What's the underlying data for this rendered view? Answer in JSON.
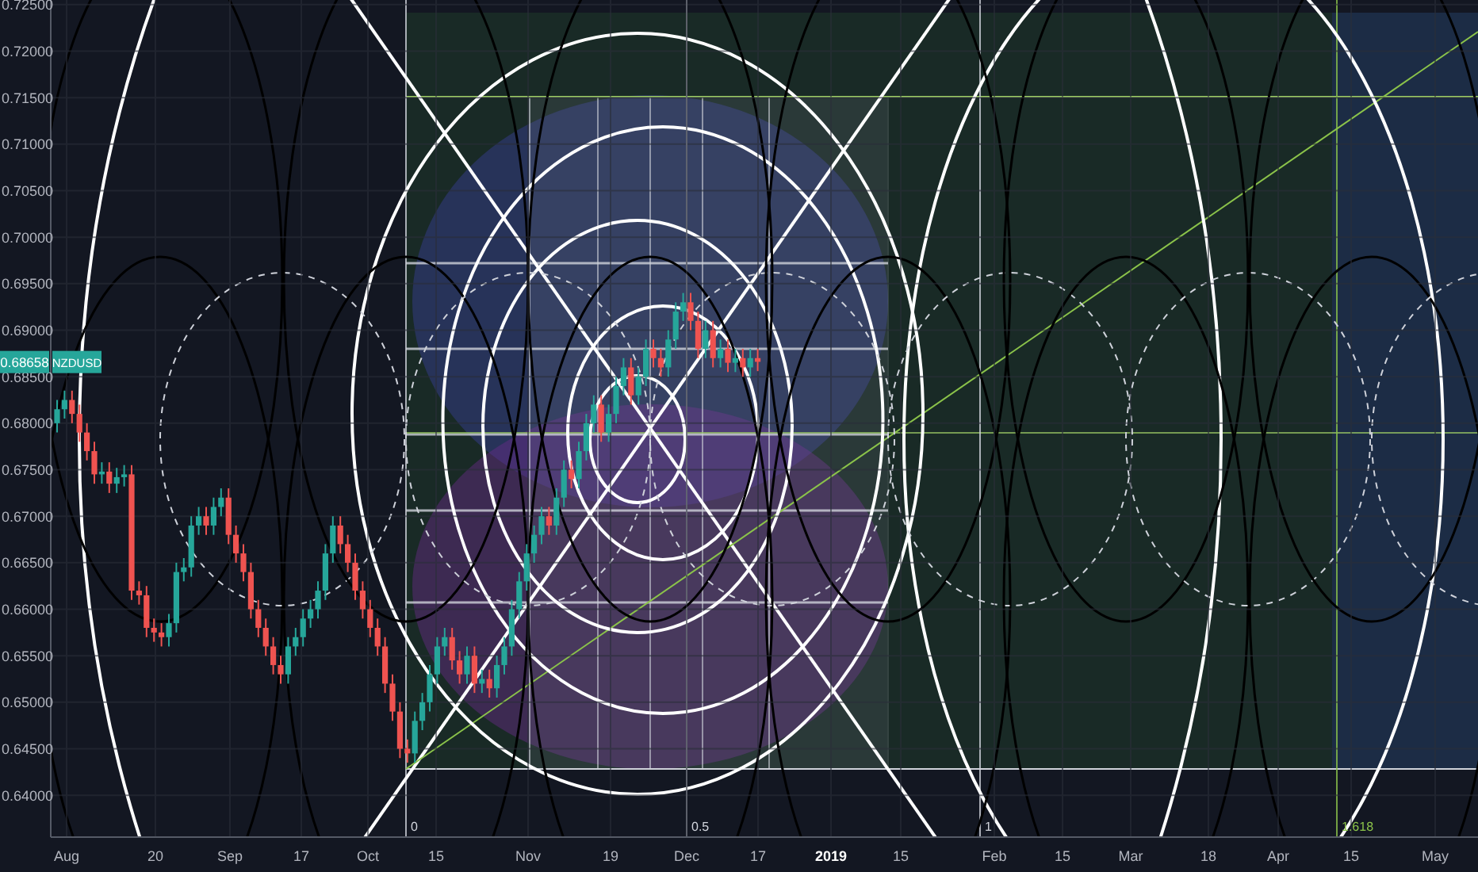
{
  "symbol": {
    "ticker": "NZDUSD",
    "last_price": "0.68658"
  },
  "chart_data": {
    "type": "candlestick",
    "grid": true,
    "ylim": [
      0.6355,
      0.7255
    ],
    "yticks": [
      {
        "value": 0.725,
        "label": "0.72500"
      },
      {
        "value": 0.72,
        "label": "0.72000"
      },
      {
        "value": 0.715,
        "label": "0.71500"
      },
      {
        "value": 0.71,
        "label": "0.71000"
      },
      {
        "value": 0.705,
        "label": "0.70500"
      },
      {
        "value": 0.7,
        "label": "0.70000"
      },
      {
        "value": 0.695,
        "label": "0.69500"
      },
      {
        "value": 0.69,
        "label": "0.69000"
      },
      {
        "value": 0.685,
        "label": "0.68500"
      },
      {
        "value": 0.68,
        "label": "0.68000"
      },
      {
        "value": 0.675,
        "label": "0.67500"
      },
      {
        "value": 0.67,
        "label": "0.67000"
      },
      {
        "value": 0.665,
        "label": "0.66500"
      },
      {
        "value": 0.66,
        "label": "0.66000"
      },
      {
        "value": 0.655,
        "label": "0.65500"
      },
      {
        "value": 0.65,
        "label": "0.65000"
      },
      {
        "value": 0.645,
        "label": "0.64500"
      },
      {
        "value": 0.64,
        "label": "0.64000"
      }
    ],
    "categories": [
      null,
      null,
      null,
      null,
      null,
      null,
      null,
      null,
      null,
      null,
      null,
      null,
      null,
      null,
      null,
      null,
      null,
      null,
      null,
      null,
      null,
      null,
      null,
      null,
      null,
      null,
      null,
      null,
      null,
      null,
      null,
      null,
      null,
      null,
      null,
      null,
      null,
      null,
      null,
      null,
      null,
      null,
      null,
      null,
      null,
      null,
      null,
      null,
      null,
      null,
      null,
      null,
      null,
      null,
      null,
      null,
      null,
      null,
      null,
      null,
      null,
      null,
      null,
      null,
      null,
      null,
      null,
      null,
      null,
      null,
      null,
      null,
      null,
      null,
      null,
      null,
      null,
      null,
      null,
      null,
      null,
      null,
      null,
      null,
      null,
      null,
      null,
      null,
      null,
      null,
      null,
      null,
      null,
      null,
      null
    ],
    "ohlc": [
      [
        0.68,
        0.6825,
        0.679,
        0.6815
      ],
      [
        0.6815,
        0.6835,
        0.6805,
        0.6825
      ],
      [
        0.6825,
        0.6835,
        0.68,
        0.681
      ],
      [
        0.681,
        0.682,
        0.678,
        0.679
      ],
      [
        0.679,
        0.68,
        0.676,
        0.677
      ],
      [
        0.677,
        0.678,
        0.6735,
        0.6745
      ],
      [
        0.6745,
        0.6758,
        0.6735,
        0.6748
      ],
      [
        0.6748,
        0.6758,
        0.6725,
        0.6735
      ],
      [
        0.6735,
        0.6752,
        0.6725,
        0.6742
      ],
      [
        0.6742,
        0.6755,
        0.6732,
        0.6745
      ],
      [
        0.6745,
        0.6755,
        0.661,
        0.662
      ],
      [
        0.662,
        0.663,
        0.6605,
        0.6615
      ],
      [
        0.6615,
        0.6625,
        0.657,
        0.658
      ],
      [
        0.658,
        0.659,
        0.6565,
        0.6575
      ],
      [
        0.6575,
        0.6585,
        0.656,
        0.657
      ],
      [
        0.657,
        0.6595,
        0.656,
        0.6585
      ],
      [
        0.6585,
        0.665,
        0.6575,
        0.664
      ],
      [
        0.664,
        0.6655,
        0.663,
        0.6645
      ],
      [
        0.6645,
        0.67,
        0.6635,
        0.669
      ],
      [
        0.669,
        0.671,
        0.668,
        0.67
      ],
      [
        0.67,
        0.671,
        0.668,
        0.669
      ],
      [
        0.669,
        0.672,
        0.668,
        0.671
      ],
      [
        0.671,
        0.673,
        0.67,
        0.672
      ],
      [
        0.672,
        0.673,
        0.667,
        0.668
      ],
      [
        0.668,
        0.669,
        0.665,
        0.666
      ],
      [
        0.666,
        0.667,
        0.663,
        0.664
      ],
      [
        0.664,
        0.665,
        0.659,
        0.66
      ],
      [
        0.66,
        0.661,
        0.657,
        0.658
      ],
      [
        0.658,
        0.659,
        0.655,
        0.656
      ],
      [
        0.656,
        0.657,
        0.653,
        0.654
      ],
      [
        0.654,
        0.655,
        0.652,
        0.653
      ],
      [
        0.653,
        0.657,
        0.652,
        0.656
      ],
      [
        0.656,
        0.658,
        0.655,
        0.657
      ],
      [
        0.657,
        0.66,
        0.656,
        0.659
      ],
      [
        0.659,
        0.661,
        0.658,
        0.66
      ],
      [
        0.66,
        0.663,
        0.659,
        0.662
      ],
      [
        0.662,
        0.667,
        0.661,
        0.666
      ],
      [
        0.666,
        0.67,
        0.665,
        0.669
      ],
      [
        0.669,
        0.67,
        0.666,
        0.667
      ],
      [
        0.667,
        0.668,
        0.664,
        0.665
      ],
      [
        0.665,
        0.666,
        0.661,
        0.662
      ],
      [
        0.662,
        0.663,
        0.659,
        0.66
      ],
      [
        0.66,
        0.661,
        0.657,
        0.658
      ],
      [
        0.658,
        0.659,
        0.655,
        0.656
      ],
      [
        0.656,
        0.657,
        0.651,
        0.652
      ],
      [
        0.652,
        0.653,
        0.648,
        0.649
      ],
      [
        0.649,
        0.65,
        0.644,
        0.645
      ],
      [
        0.645,
        0.646,
        0.6435,
        0.6445
      ],
      [
        0.6445,
        0.649,
        0.6435,
        0.648
      ],
      [
        0.648,
        0.651,
        0.647,
        0.65
      ],
      [
        0.65,
        0.654,
        0.649,
        0.653
      ],
      [
        0.653,
        0.657,
        0.652,
        0.656
      ],
      [
        0.656,
        0.658,
        0.655,
        0.657
      ],
      [
        0.657,
        0.658,
        0.6535,
        0.6545
      ],
      [
        0.6545,
        0.6555,
        0.652,
        0.653
      ],
      [
        0.653,
        0.656,
        0.652,
        0.655
      ],
      [
        0.655,
        0.656,
        0.651,
        0.652
      ],
      [
        0.652,
        0.6535,
        0.651,
        0.6525
      ],
      [
        0.6525,
        0.6535,
        0.6505,
        0.6515
      ],
      [
        0.6515,
        0.655,
        0.6505,
        0.654
      ],
      [
        0.654,
        0.657,
        0.653,
        0.656
      ],
      [
        0.656,
        0.661,
        0.655,
        0.66
      ],
      [
        0.66,
        0.664,
        0.659,
        0.663
      ],
      [
        0.663,
        0.667,
        0.662,
        0.666
      ],
      [
        0.666,
        0.669,
        0.665,
        0.668
      ],
      [
        0.668,
        0.671,
        0.667,
        0.67
      ],
      [
        0.67,
        0.671,
        0.668,
        0.669
      ],
      [
        0.669,
        0.673,
        0.668,
        0.672
      ],
      [
        0.672,
        0.676,
        0.671,
        0.675
      ],
      [
        0.675,
        0.676,
        0.673,
        0.674
      ],
      [
        0.674,
        0.678,
        0.673,
        0.677
      ],
      [
        0.677,
        0.681,
        0.676,
        0.68
      ],
      [
        0.68,
        0.683,
        0.679,
        0.682
      ],
      [
        0.682,
        0.683,
        0.678,
        0.679
      ],
      [
        0.679,
        0.682,
        0.678,
        0.681
      ],
      [
        0.681,
        0.685,
        0.68,
        0.684
      ],
      [
        0.684,
        0.687,
        0.683,
        0.686
      ],
      [
        0.686,
        0.687,
        0.682,
        0.683
      ],
      [
        0.683,
        0.686,
        0.682,
        0.685
      ],
      [
        0.685,
        0.689,
        0.684,
        0.688
      ],
      [
        0.688,
        0.689,
        0.686,
        0.687
      ],
      [
        0.687,
        0.688,
        0.685,
        0.686
      ],
      [
        0.686,
        0.69,
        0.685,
        0.689
      ],
      [
        0.689,
        0.693,
        0.688,
        0.692
      ],
      [
        0.692,
        0.694,
        0.691,
        0.693
      ],
      [
        0.693,
        0.694,
        0.69,
        0.691
      ],
      [
        0.691,
        0.692,
        0.687,
        0.688
      ],
      [
        0.688,
        0.691,
        0.687,
        0.69
      ],
      [
        0.69,
        0.691,
        0.686,
        0.687
      ],
      [
        0.687,
        0.689,
        0.686,
        0.688
      ],
      [
        0.688,
        0.689,
        0.6855,
        0.6865
      ],
      [
        0.6865,
        0.688,
        0.6855,
        0.687
      ],
      [
        0.687,
        0.688,
        0.685,
        0.686
      ],
      [
        0.686,
        0.688,
        0.685,
        0.687
      ],
      [
        0.687,
        0.688,
        0.6856,
        0.6866
      ]
    ]
  },
  "time_axis": {
    "ticks": [
      {
        "label": "Aug",
        "bold": false
      },
      {
        "label": "20",
        "bold": false
      },
      {
        "label": "Sep",
        "bold": false
      },
      {
        "label": "17",
        "bold": false
      },
      {
        "label": "Oct",
        "bold": false
      },
      {
        "label": "15",
        "bold": false
      },
      {
        "label": "Nov",
        "bold": false
      },
      {
        "label": "19",
        "bold": false
      },
      {
        "label": "Dec",
        "bold": false
      },
      {
        "label": "17",
        "bold": false
      },
      {
        "label": "2019",
        "bold": true
      },
      {
        "label": "15",
        "bold": false
      },
      {
        "label": "Feb",
        "bold": false
      },
      {
        "label": "15",
        "bold": false
      },
      {
        "label": "Mar",
        "bold": false
      },
      {
        "label": "18",
        "bold": false
      },
      {
        "label": "Apr",
        "bold": false
      },
      {
        "label": "15",
        "bold": false
      },
      {
        "label": "May",
        "bold": false
      }
    ]
  },
  "fib_levels": [
    {
      "label": "0",
      "color": "#d1d4dc"
    },
    {
      "label": "0.5",
      "color": "#d1d4dc"
    },
    {
      "label": "1",
      "color": "#d1d4dc"
    },
    {
      "label": "1.618",
      "color": "#8bc34a"
    }
  ]
}
